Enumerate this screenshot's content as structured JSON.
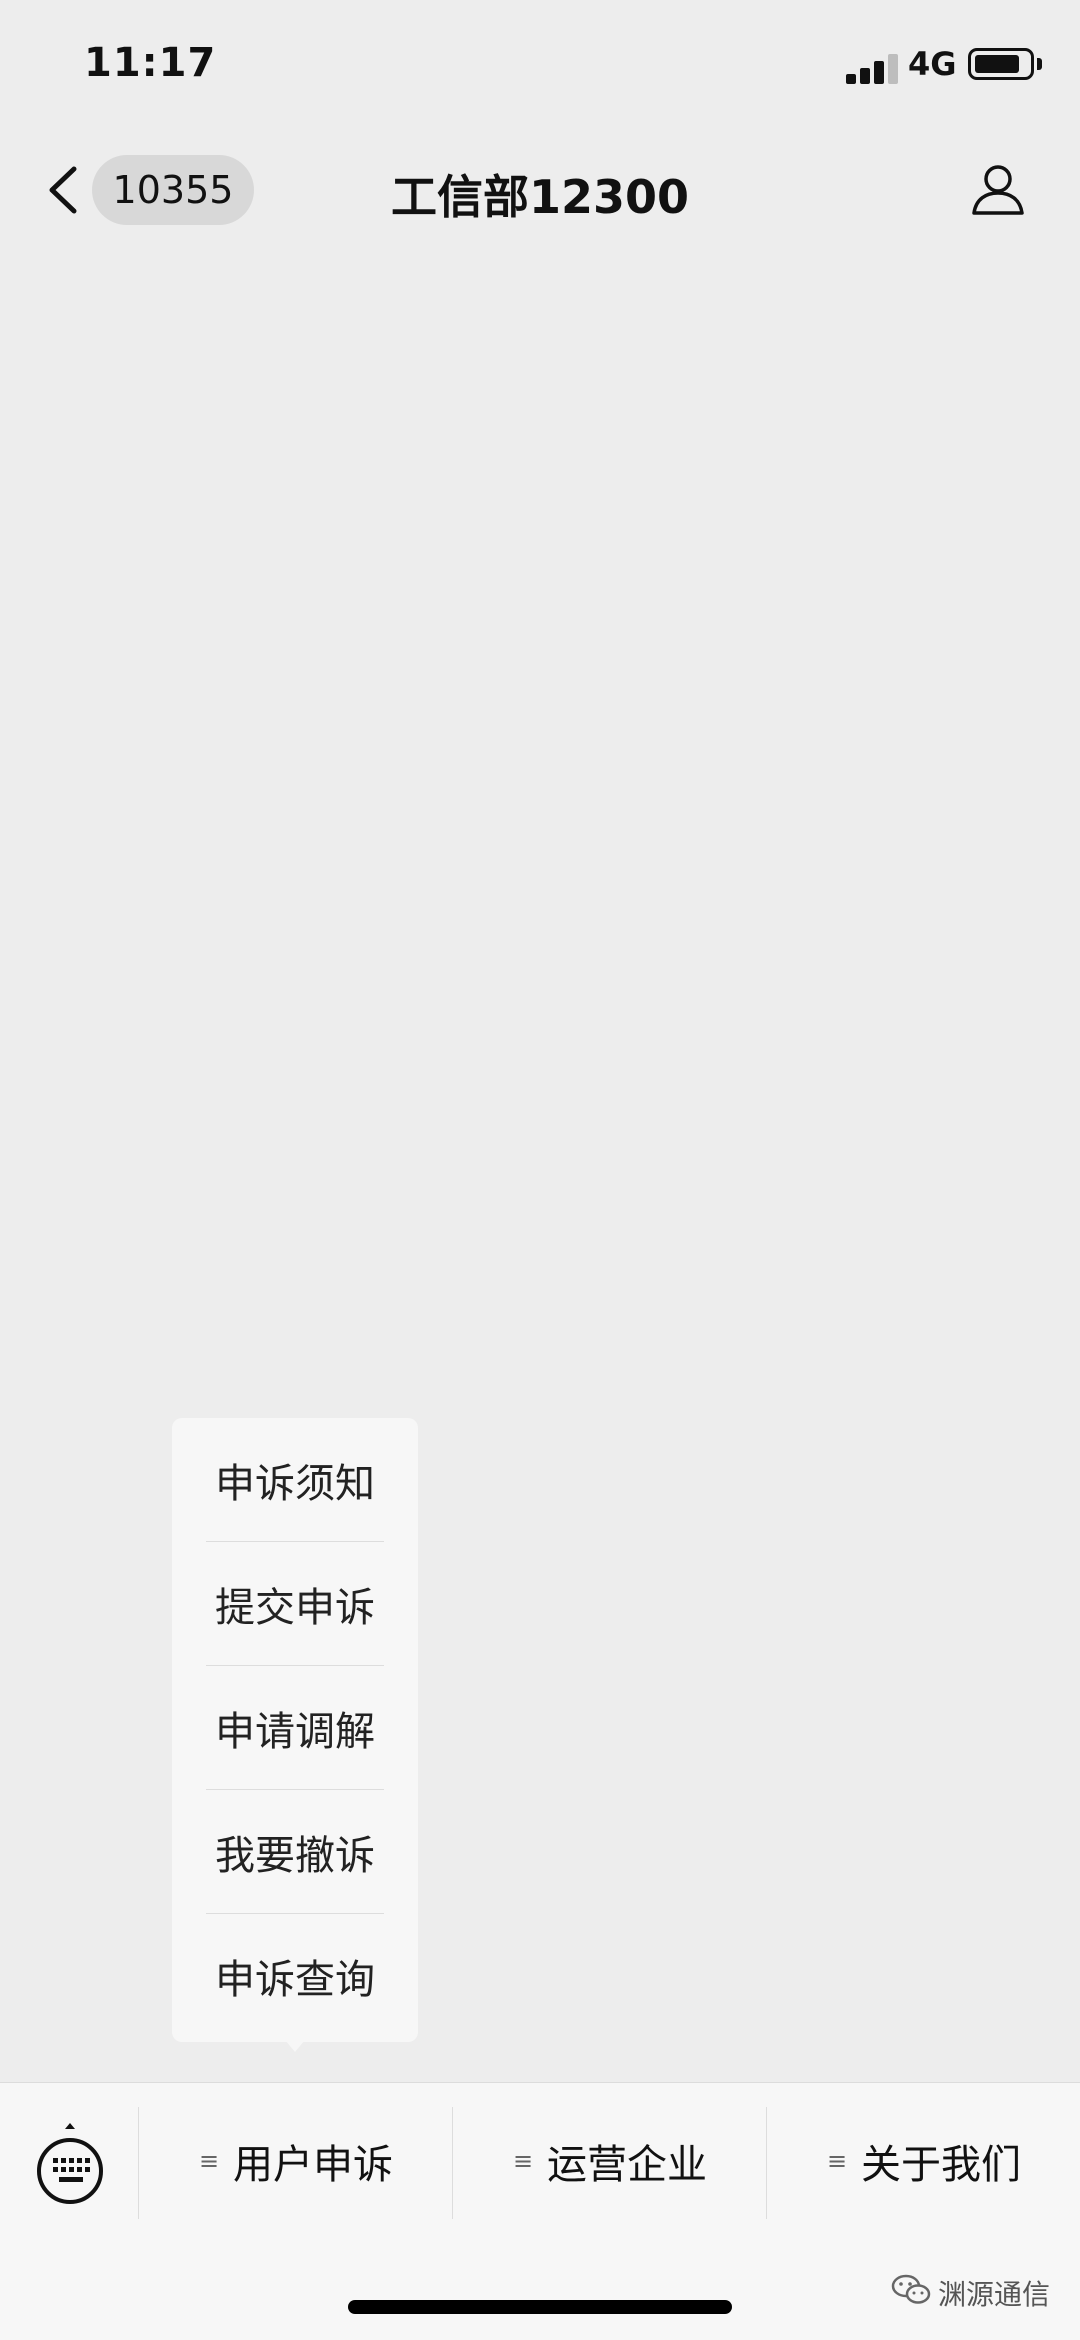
{
  "status_bar": {
    "time": "11:17",
    "network": "4G"
  },
  "nav": {
    "unread_count": "10355",
    "title": "工信部12300"
  },
  "popup": {
    "items": [
      "申诉须知",
      "提交申诉",
      "申请调解",
      "我要撤诉",
      "申诉查询"
    ]
  },
  "bottom_menu": {
    "tabs": [
      "用户申诉",
      "运营企业",
      "关于我们"
    ]
  },
  "watermark": {
    "text": "渊源通信"
  },
  "icons": {
    "back": "chevron-left-icon",
    "profile": "person-icon",
    "keyboard": "keyboard-icon",
    "menu_lines": "lines-icon",
    "watermark": "wechat-icon"
  }
}
